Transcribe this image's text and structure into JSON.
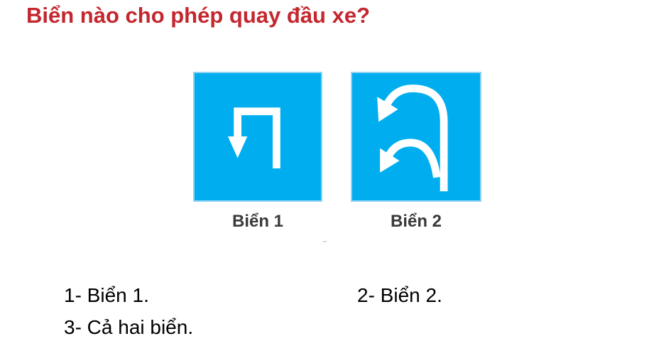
{
  "question": "Biển nào cho phép quay đầu xe?",
  "signs": [
    {
      "caption": "Biển 1",
      "icon": "u-turn-arrow-icon"
    },
    {
      "caption": "Biển 2",
      "icon": "double-u-turn-arrow-icon"
    }
  ],
  "options": [
    "1- Biển 1.",
    "2- Biển 2.",
    "3- Cả hai biển."
  ],
  "colors": {
    "question": "#c4262e",
    "sign_background": "#00aeef",
    "sign_symbol": "#ffffff",
    "caption": "#3a3a3a"
  }
}
